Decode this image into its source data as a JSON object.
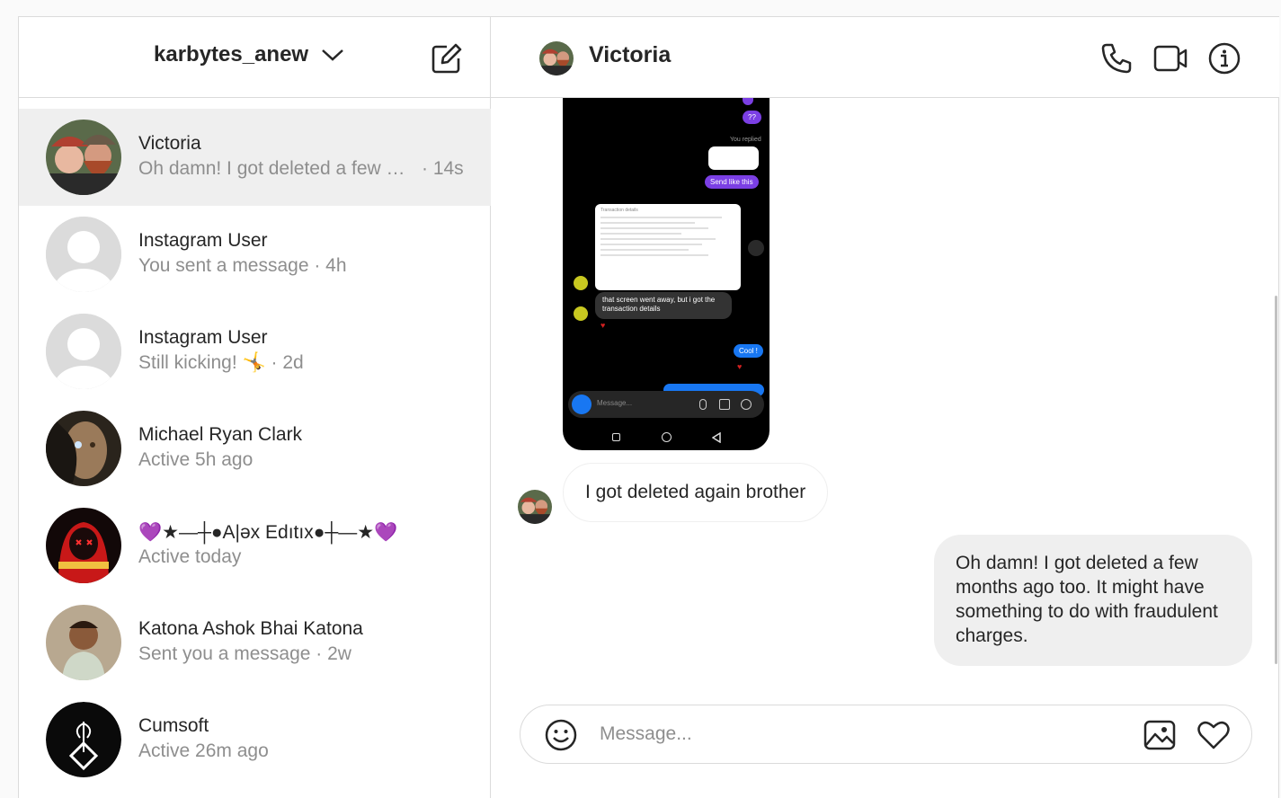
{
  "account": {
    "username": "karbytes_anew"
  },
  "threads": [
    {
      "name": "Victoria",
      "preview": "Oh damn! I got deleted a few …",
      "time": "· 14s",
      "active": true
    },
    {
      "name": "Instagram User",
      "preview": "You sent a message · 4h"
    },
    {
      "name": "Instagram User",
      "preview": "Still kicking! 🤸 · 2d"
    },
    {
      "name": "Michael Ryan Clark",
      "preview": "Active 5h ago"
    },
    {
      "name": "💜★—┼●A|əx Edıtıx●┼—★💜",
      "preview": "Active today"
    },
    {
      "name": "Katona Ashok Bhai Katona",
      "preview": "Sent you a message · 2w"
    },
    {
      "name": "Cumsoft",
      "preview": "Active 26m ago"
    }
  ],
  "conversation": {
    "contact_name": "Victoria",
    "shared_image": {
      "you_replied": "You replied",
      "send_like_this": "Send like this",
      "qq": "??",
      "transaction_header": "Transaction details",
      "gray_bubble": "that screen went away, but i got the transaction details",
      "cool": "Cool !",
      "message_placeholder": "Message..."
    },
    "incoming_message": "I got deleted again brother",
    "outgoing_message": "Oh damn! I got deleted a few months ago too. It might have something to do with fraudulent charges."
  },
  "composer": {
    "placeholder": "Message..."
  }
}
